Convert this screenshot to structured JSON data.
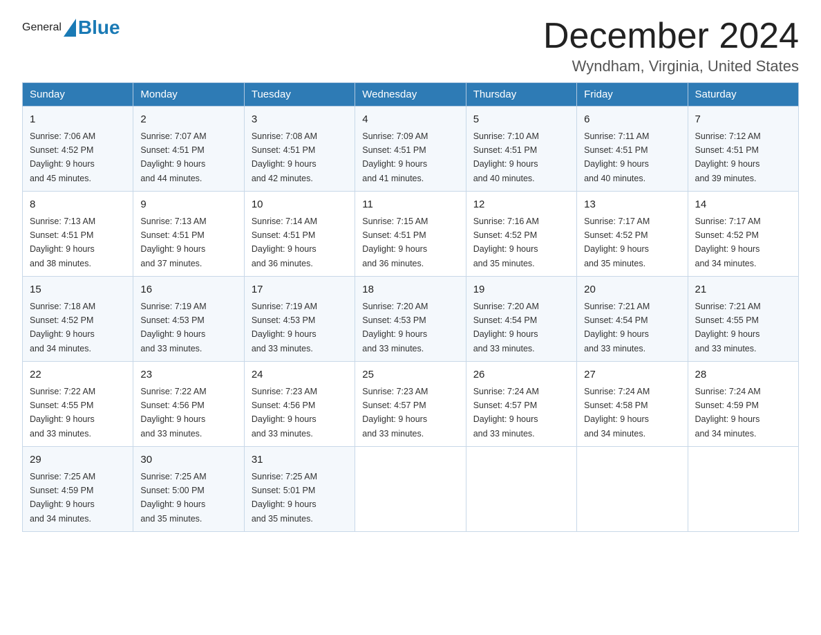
{
  "header": {
    "logo_general": "General",
    "logo_blue": "Blue",
    "title": "December 2024",
    "subtitle": "Wyndham, Virginia, United States"
  },
  "columns": [
    "Sunday",
    "Monday",
    "Tuesday",
    "Wednesday",
    "Thursday",
    "Friday",
    "Saturday"
  ],
  "weeks": [
    [
      {
        "day": "1",
        "sunrise": "7:06 AM",
        "sunset": "4:52 PM",
        "daylight": "9 hours and 45 minutes."
      },
      {
        "day": "2",
        "sunrise": "7:07 AM",
        "sunset": "4:51 PM",
        "daylight": "9 hours and 44 minutes."
      },
      {
        "day": "3",
        "sunrise": "7:08 AM",
        "sunset": "4:51 PM",
        "daylight": "9 hours and 42 minutes."
      },
      {
        "day": "4",
        "sunrise": "7:09 AM",
        "sunset": "4:51 PM",
        "daylight": "9 hours and 41 minutes."
      },
      {
        "day": "5",
        "sunrise": "7:10 AM",
        "sunset": "4:51 PM",
        "daylight": "9 hours and 40 minutes."
      },
      {
        "day": "6",
        "sunrise": "7:11 AM",
        "sunset": "4:51 PM",
        "daylight": "9 hours and 40 minutes."
      },
      {
        "day": "7",
        "sunrise": "7:12 AM",
        "sunset": "4:51 PM",
        "daylight": "9 hours and 39 minutes."
      }
    ],
    [
      {
        "day": "8",
        "sunrise": "7:13 AM",
        "sunset": "4:51 PM",
        "daylight": "9 hours and 38 minutes."
      },
      {
        "day": "9",
        "sunrise": "7:13 AM",
        "sunset": "4:51 PM",
        "daylight": "9 hours and 37 minutes."
      },
      {
        "day": "10",
        "sunrise": "7:14 AM",
        "sunset": "4:51 PM",
        "daylight": "9 hours and 36 minutes."
      },
      {
        "day": "11",
        "sunrise": "7:15 AM",
        "sunset": "4:51 PM",
        "daylight": "9 hours and 36 minutes."
      },
      {
        "day": "12",
        "sunrise": "7:16 AM",
        "sunset": "4:52 PM",
        "daylight": "9 hours and 35 minutes."
      },
      {
        "day": "13",
        "sunrise": "7:17 AM",
        "sunset": "4:52 PM",
        "daylight": "9 hours and 35 minutes."
      },
      {
        "day": "14",
        "sunrise": "7:17 AM",
        "sunset": "4:52 PM",
        "daylight": "9 hours and 34 minutes."
      }
    ],
    [
      {
        "day": "15",
        "sunrise": "7:18 AM",
        "sunset": "4:52 PM",
        "daylight": "9 hours and 34 minutes."
      },
      {
        "day": "16",
        "sunrise": "7:19 AM",
        "sunset": "4:53 PM",
        "daylight": "9 hours and 33 minutes."
      },
      {
        "day": "17",
        "sunrise": "7:19 AM",
        "sunset": "4:53 PM",
        "daylight": "9 hours and 33 minutes."
      },
      {
        "day": "18",
        "sunrise": "7:20 AM",
        "sunset": "4:53 PM",
        "daylight": "9 hours and 33 minutes."
      },
      {
        "day": "19",
        "sunrise": "7:20 AM",
        "sunset": "4:54 PM",
        "daylight": "9 hours and 33 minutes."
      },
      {
        "day": "20",
        "sunrise": "7:21 AM",
        "sunset": "4:54 PM",
        "daylight": "9 hours and 33 minutes."
      },
      {
        "day": "21",
        "sunrise": "7:21 AM",
        "sunset": "4:55 PM",
        "daylight": "9 hours and 33 minutes."
      }
    ],
    [
      {
        "day": "22",
        "sunrise": "7:22 AM",
        "sunset": "4:55 PM",
        "daylight": "9 hours and 33 minutes."
      },
      {
        "day": "23",
        "sunrise": "7:22 AM",
        "sunset": "4:56 PM",
        "daylight": "9 hours and 33 minutes."
      },
      {
        "day": "24",
        "sunrise": "7:23 AM",
        "sunset": "4:56 PM",
        "daylight": "9 hours and 33 minutes."
      },
      {
        "day": "25",
        "sunrise": "7:23 AM",
        "sunset": "4:57 PM",
        "daylight": "9 hours and 33 minutes."
      },
      {
        "day": "26",
        "sunrise": "7:24 AM",
        "sunset": "4:57 PM",
        "daylight": "9 hours and 33 minutes."
      },
      {
        "day": "27",
        "sunrise": "7:24 AM",
        "sunset": "4:58 PM",
        "daylight": "9 hours and 34 minutes."
      },
      {
        "day": "28",
        "sunrise": "7:24 AM",
        "sunset": "4:59 PM",
        "daylight": "9 hours and 34 minutes."
      }
    ],
    [
      {
        "day": "29",
        "sunrise": "7:25 AM",
        "sunset": "4:59 PM",
        "daylight": "9 hours and 34 minutes."
      },
      {
        "day": "30",
        "sunrise": "7:25 AM",
        "sunset": "5:00 PM",
        "daylight": "9 hours and 35 minutes."
      },
      {
        "day": "31",
        "sunrise": "7:25 AM",
        "sunset": "5:01 PM",
        "daylight": "9 hours and 35 minutes."
      },
      null,
      null,
      null,
      null
    ]
  ],
  "labels": {
    "sunrise": "Sunrise:",
    "sunset": "Sunset:",
    "daylight": "Daylight:"
  }
}
